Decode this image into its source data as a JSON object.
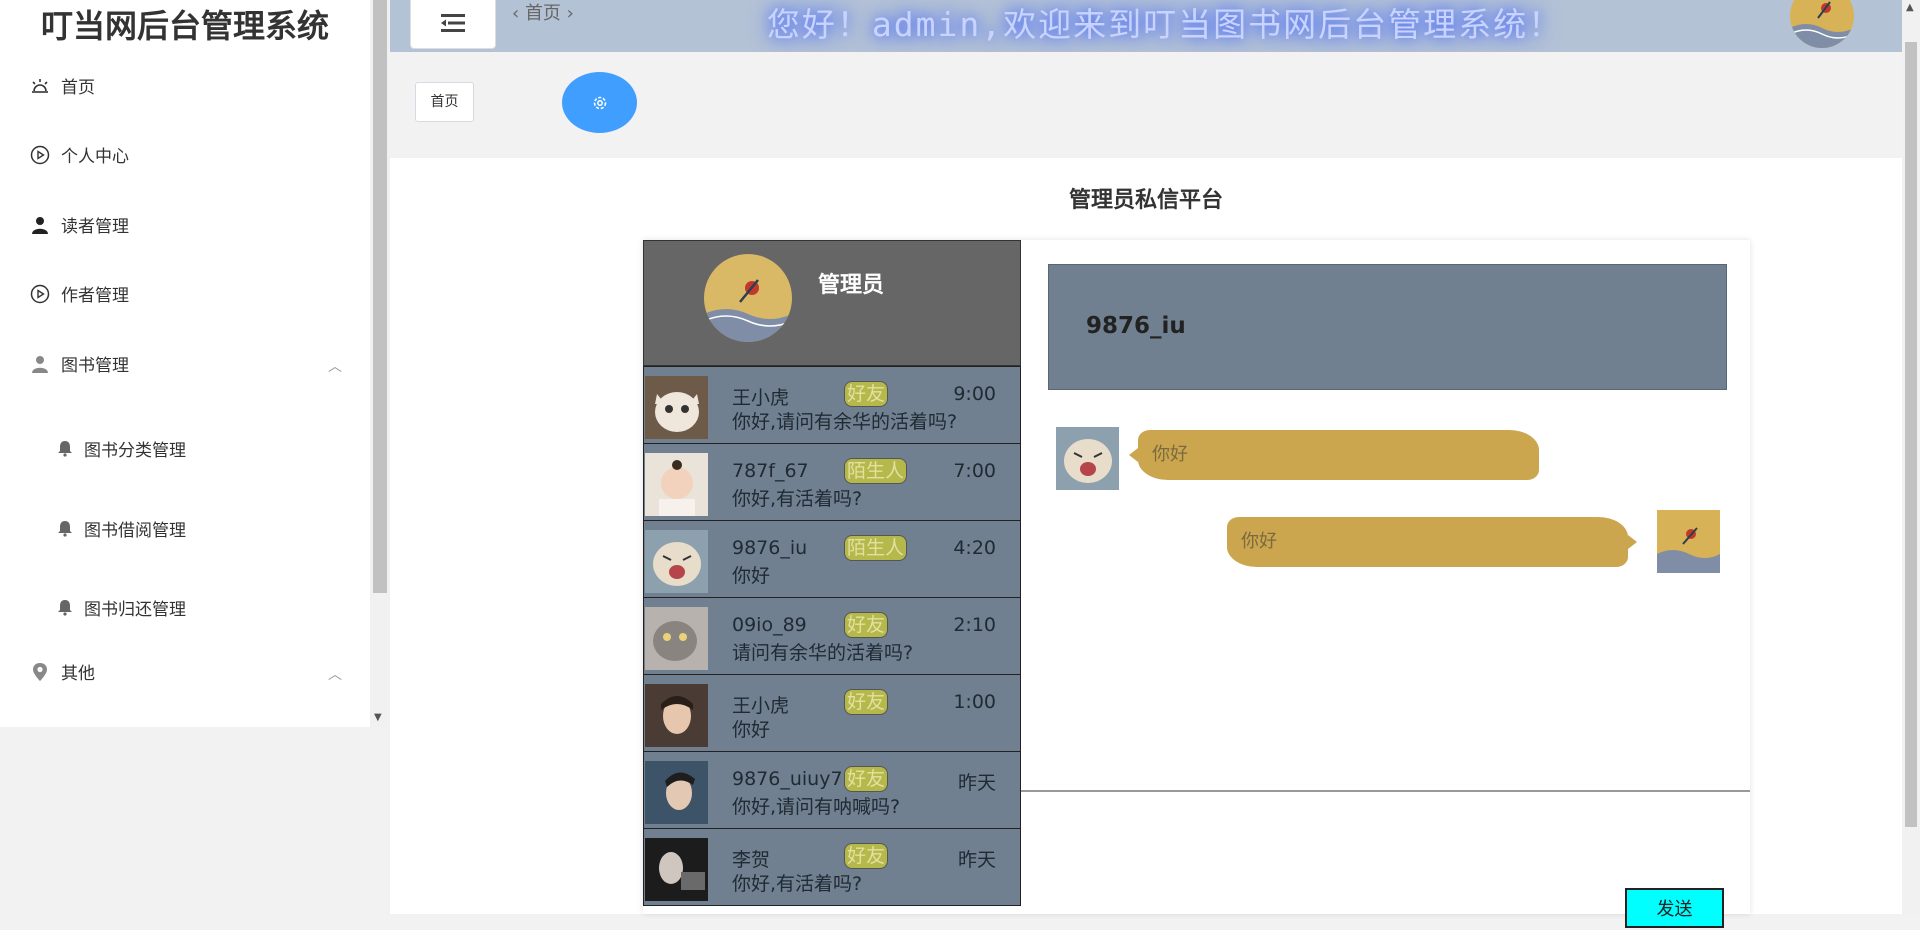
{
  "sidebar": {
    "brand": "叮当网后台管理系统",
    "items": [
      {
        "label": "首页",
        "icon": "alarm-icon"
      },
      {
        "label": "个人中心",
        "icon": "play-circle-icon"
      },
      {
        "label": "读者管理",
        "icon": "user-icon"
      },
      {
        "label": "作者管理",
        "icon": "play-circle-icon"
      },
      {
        "label": "图书管理",
        "icon": "user-icon"
      }
    ],
    "submenu": [
      {
        "label": "图书分类管理",
        "icon": "bell-icon"
      },
      {
        "label": "图书借阅管理",
        "icon": "bell-icon"
      },
      {
        "label": "图书归还管理",
        "icon": "bell-icon"
      }
    ],
    "other": {
      "label": "其他",
      "icon": "location-icon"
    }
  },
  "header": {
    "breadcrumb": "首页",
    "welcome": "您好！admin,欢迎来到叮当图书网后台管理系统！"
  },
  "tabs": {
    "home": "首页"
  },
  "page": {
    "title": "管理员私信平台"
  },
  "chat": {
    "me": {
      "name": "管理员"
    },
    "contacts": [
      {
        "name": "王小虎",
        "tag": "好友",
        "time": "9:00",
        "message": "你好,请问有余华的活着吗?"
      },
      {
        "name": "787f_67",
        "tag": "陌生人",
        "time": "7:00",
        "message": "你好,有活着吗?"
      },
      {
        "name": "9876_iu",
        "tag": "陌生人",
        "time": "4:20",
        "message": "你好"
      },
      {
        "name": "09io_89",
        "tag": "好友",
        "time": "2:10",
        "message": "请问有余华的活着吗?"
      },
      {
        "name": "王小虎",
        "tag": "好友",
        "time": "1:00",
        "message": "你好"
      },
      {
        "name": "9876_uiuy7",
        "tag": "好友",
        "time": "昨天",
        "message": "你好,请问有呐喊吗?"
      },
      {
        "name": "李贺",
        "tag": "好友",
        "time": "昨天",
        "message": "你好,有活着吗?"
      }
    ],
    "conversation": {
      "title": "9876_iu",
      "messages": [
        {
          "from": "them",
          "text": "你好"
        },
        {
          "from": "me",
          "text": "你好"
        }
      ]
    },
    "send_label": "发送"
  },
  "colors": {
    "header_bg": "#b4c2d6",
    "accent": "#409eff",
    "contact_bg": "#708090",
    "bubble": "#cca64e",
    "send_btn": "#00ffff"
  }
}
